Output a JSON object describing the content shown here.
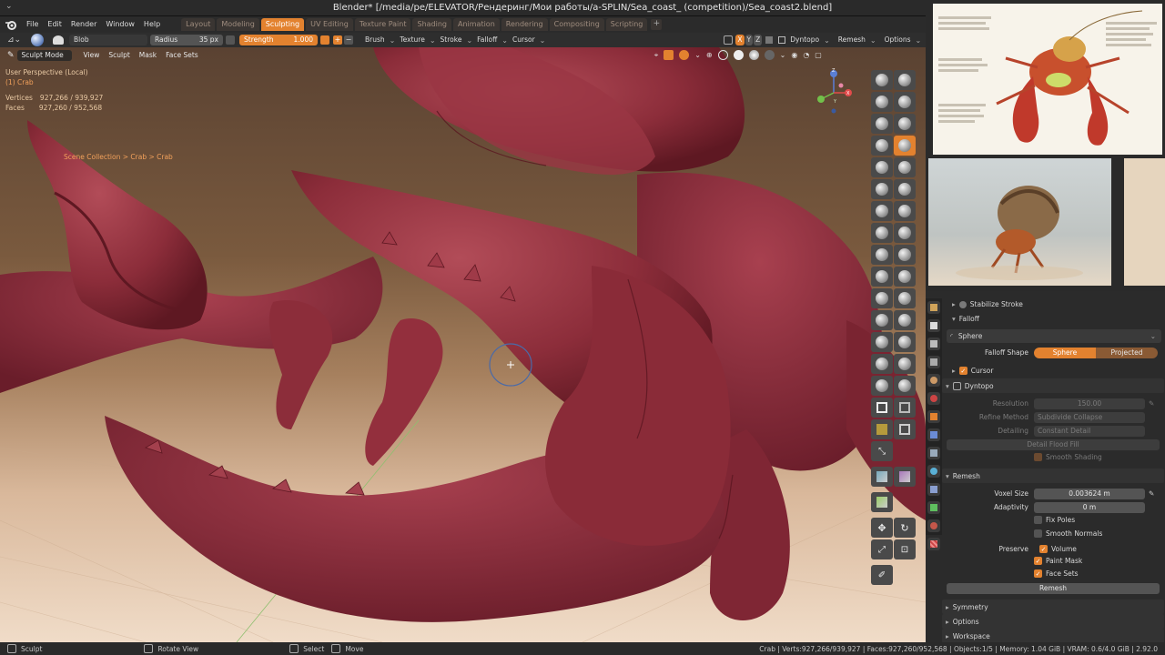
{
  "title": "Blender* [/media/pe/ELEVATOR/Рендеринг/Мои работы/a-SPLIN/Sea_coast_ (competition)/Sea_coast2.blend]",
  "menu": [
    "File",
    "Edit",
    "Render",
    "Window",
    "Help"
  ],
  "tabs": [
    {
      "label": "Layout",
      "active": false
    },
    {
      "label": "Modeling",
      "active": false
    },
    {
      "label": "Sculpting",
      "active": true
    },
    {
      "label": "UV Editing",
      "active": false
    },
    {
      "label": "Texture Paint",
      "active": false
    },
    {
      "label": "Shading",
      "active": false
    },
    {
      "label": "Animation",
      "active": false
    },
    {
      "label": "Rendering",
      "active": false
    },
    {
      "label": "Compositing",
      "active": false
    },
    {
      "label": "Scripting",
      "active": false
    }
  ],
  "toolheader": {
    "brush_name": "Blob",
    "radius_label": "Radius",
    "radius_value": "35 px",
    "strength_label": "Strength",
    "strength_value": "1.000",
    "menus": [
      "Brush",
      "Texture",
      "Stroke",
      "Falloff",
      "Cursor"
    ],
    "axes": [
      "X",
      "Y",
      "Z"
    ],
    "dyntopo": "Dyntopo",
    "remesh": "Remesh",
    "options": "Options"
  },
  "vpheader": {
    "mode": "Sculpt Mode",
    "menus": [
      "View",
      "Sculpt",
      "Mask",
      "Face Sets"
    ]
  },
  "overlay": {
    "perspective": "User Perspective (Local)",
    "object": "(1) Crab",
    "vertices_label": "Vertices",
    "vertices_value": "927,266 / 939,927",
    "faces_label": "Faces",
    "faces_value": "927,260 / 952,568",
    "breadcrumb": "Scene Collection  >  Crab  >  Crab"
  },
  "gizmo": {
    "axes": [
      "X",
      "Y",
      "Z"
    ]
  },
  "props": {
    "stabilize": "Stabilize Stroke",
    "falloff": "Falloff",
    "falloff_preset": "Sphere",
    "falloff_shape_label": "Falloff Shape",
    "falloff_shape_options": [
      "Sphere",
      "Projected"
    ],
    "cursor": "Cursor",
    "dyntopo": "Dyntopo",
    "resolution_label": "Resolution",
    "resolution_value": "150.00",
    "refine_label": "Refine Method",
    "refine_value": "Subdivide Collapse",
    "detailing_label": "Detailing",
    "detailing_value": "Constant Detail",
    "detail_flood_fill": "Detail Flood Fill",
    "smooth_shading": "Smooth Shading",
    "remesh": "Remesh",
    "voxel_label": "Voxel Size",
    "voxel_value": "0.003624 m",
    "adaptivity_label": "Adaptivity",
    "adaptivity_value": "0 m",
    "fix_poles": "Fix Poles",
    "smooth_normals": "Smooth Normals",
    "preserve_label": "Preserve",
    "preserve_volume": "Volume",
    "preserve_paint_mask": "Paint Mask",
    "preserve_face_sets": "Face Sets",
    "remesh_button": "Remesh",
    "symmetry": "Symmetry",
    "options": "Options",
    "workspace": "Workspace"
  },
  "status": {
    "left": "Sculpt",
    "rotate": "Rotate View",
    "select": "Select",
    "move": "Move",
    "right": "Crab | Verts:927,266/939,927 | Faces:927,260/952,568 | Objects:1/5 | Memory: 1.04 GiB | VRAM: 0.6/4.0 GiB | 2.92.0"
  },
  "colors": {
    "accent": "#e3822f",
    "crab": "#8e2f3a",
    "bg_dark": "#2b2b2b"
  }
}
